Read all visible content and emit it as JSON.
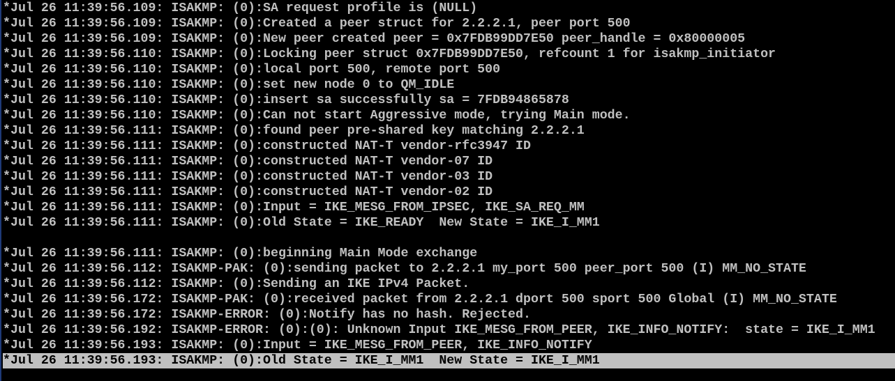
{
  "terminal": {
    "lines": [
      {
        "text": "*Jul 26 11:39:56.109: ISAKMP: (0):SA request profile is (NULL)",
        "highlight": false
      },
      {
        "text": "*Jul 26 11:39:56.109: ISAKMP: (0):Created a peer struct for 2.2.2.1, peer port 500",
        "highlight": false
      },
      {
        "text": "*Jul 26 11:39:56.109: ISAKMP: (0):New peer created peer = 0x7FDB99DD7E50 peer_handle = 0x80000005",
        "highlight": false
      },
      {
        "text": "*Jul 26 11:39:56.110: ISAKMP: (0):Locking peer struct 0x7FDB99DD7E50, refcount 1 for isakmp_initiator",
        "highlight": false
      },
      {
        "text": "*Jul 26 11:39:56.110: ISAKMP: (0):local port 500, remote port 500",
        "highlight": false
      },
      {
        "text": "*Jul 26 11:39:56.110: ISAKMP: (0):set new node 0 to QM_IDLE",
        "highlight": false
      },
      {
        "text": "*Jul 26 11:39:56.110: ISAKMP: (0):insert sa successfully sa = 7FDB94865878",
        "highlight": false
      },
      {
        "text": "*Jul 26 11:39:56.110: ISAKMP: (0):Can not start Aggressive mode, trying Main mode.",
        "highlight": false
      },
      {
        "text": "*Jul 26 11:39:56.111: ISAKMP: (0):found peer pre-shared key matching 2.2.2.1",
        "highlight": false
      },
      {
        "text": "*Jul 26 11:39:56.111: ISAKMP: (0):constructed NAT-T vendor-rfc3947 ID",
        "highlight": false
      },
      {
        "text": "*Jul 26 11:39:56.111: ISAKMP: (0):constructed NAT-T vendor-07 ID",
        "highlight": false
      },
      {
        "text": "*Jul 26 11:39:56.111: ISAKMP: (0):constructed NAT-T vendor-03 ID",
        "highlight": false
      },
      {
        "text": "*Jul 26 11:39:56.111: ISAKMP: (0):constructed NAT-T vendor-02 ID",
        "highlight": false
      },
      {
        "text": "*Jul 26 11:39:56.111: ISAKMP: (0):Input = IKE_MESG_FROM_IPSEC, IKE_SA_REQ_MM",
        "highlight": false
      },
      {
        "text": "*Jul 26 11:39:56.111: ISAKMP: (0):Old State = IKE_READY  New State = IKE_I_MM1",
        "highlight": false
      },
      {
        "text": "",
        "highlight": false
      },
      {
        "text": "*Jul 26 11:39:56.111: ISAKMP: (0):beginning Main Mode exchange",
        "highlight": false
      },
      {
        "text": "*Jul 26 11:39:56.112: ISAKMP-PAK: (0):sending packet to 2.2.2.1 my_port 500 peer_port 500 (I) MM_NO_STATE",
        "highlight": false
      },
      {
        "text": "*Jul 26 11:39:56.112: ISAKMP: (0):Sending an IKE IPv4 Packet.",
        "highlight": false
      },
      {
        "text": "*Jul 26 11:39:56.172: ISAKMP-PAK: (0):received packet from 2.2.2.1 dport 500 sport 500 Global (I) MM_NO_STATE",
        "highlight": false
      },
      {
        "text": "*Jul 26 11:39:56.172: ISAKMP-ERROR: (0):Notify has no hash. Rejected.",
        "highlight": false
      },
      {
        "text": "*Jul 26 11:39:56.192: ISAKMP-ERROR: (0):(0): Unknown Input IKE_MESG_FROM_PEER, IKE_INFO_NOTIFY:  state = IKE_I_MM1",
        "highlight": false
      },
      {
        "text": "*Jul 26 11:39:56.193: ISAKMP: (0):Input = IKE_MESG_FROM_PEER, IKE_INFO_NOTIFY",
        "highlight": false
      },
      {
        "text": "*Jul 26 11:39:56.193: ISAKMP: (0):Old State = IKE_I_MM1  New State = IKE_I_MM1",
        "highlight": true
      }
    ]
  },
  "colors": {
    "background": "#000000",
    "text": "#c0c0c0",
    "highlight_background": "#c0c0c0",
    "highlight_text": "#000000"
  }
}
